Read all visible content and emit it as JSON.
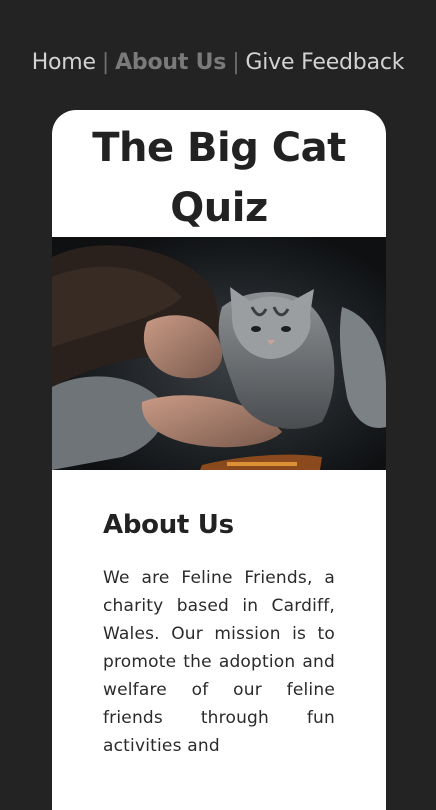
{
  "nav": {
    "home": "Home",
    "about": "About Us",
    "feedback": "Give Feedback",
    "separator": "|"
  },
  "card": {
    "title": "The Big Cat Quiz",
    "image_alt": "girl-with-cat-photo"
  },
  "about": {
    "heading": "About Us",
    "text": "We are Feline Friends, a charity based in Cardiff, Wales. Our mission is to promote the adoption and welfare of our feline friends through fun activities and"
  },
  "colors": {
    "background": "#232323",
    "card": "#ffffff",
    "nav_text": "#d2d2d2",
    "nav_active": "#7a7a7a",
    "heading": "#222222"
  }
}
